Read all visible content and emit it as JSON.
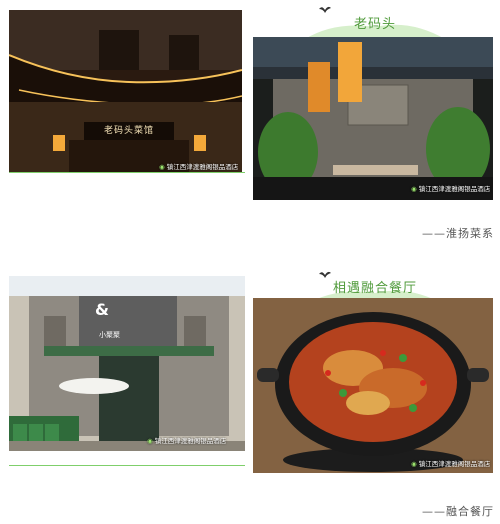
{
  "section1": {
    "title": "老码头",
    "caption": "——淮扬菜系",
    "left_photo": {
      "sign_text": "老码头菜馆",
      "watermark": "镇江西津渡雅阁银品酒店"
    },
    "right_photo": {
      "watermark": "镇江西津渡雅阁银品酒店"
    }
  },
  "section2": {
    "title": "相遇融合餐厅",
    "caption": "——融合餐厅",
    "left_photo": {
      "sign_logo": "&",
      "sign_text": "小聚聚",
      "watermark": "镇江西津渡雅阁银品酒店"
    },
    "right_photo": {
      "watermark": "镇江西津渡雅阁银品酒店"
    }
  },
  "colors": {
    "accent_green": "#4f9a3a",
    "underline_green": "#7fcf6b",
    "hill_green": "#d6efcb"
  }
}
